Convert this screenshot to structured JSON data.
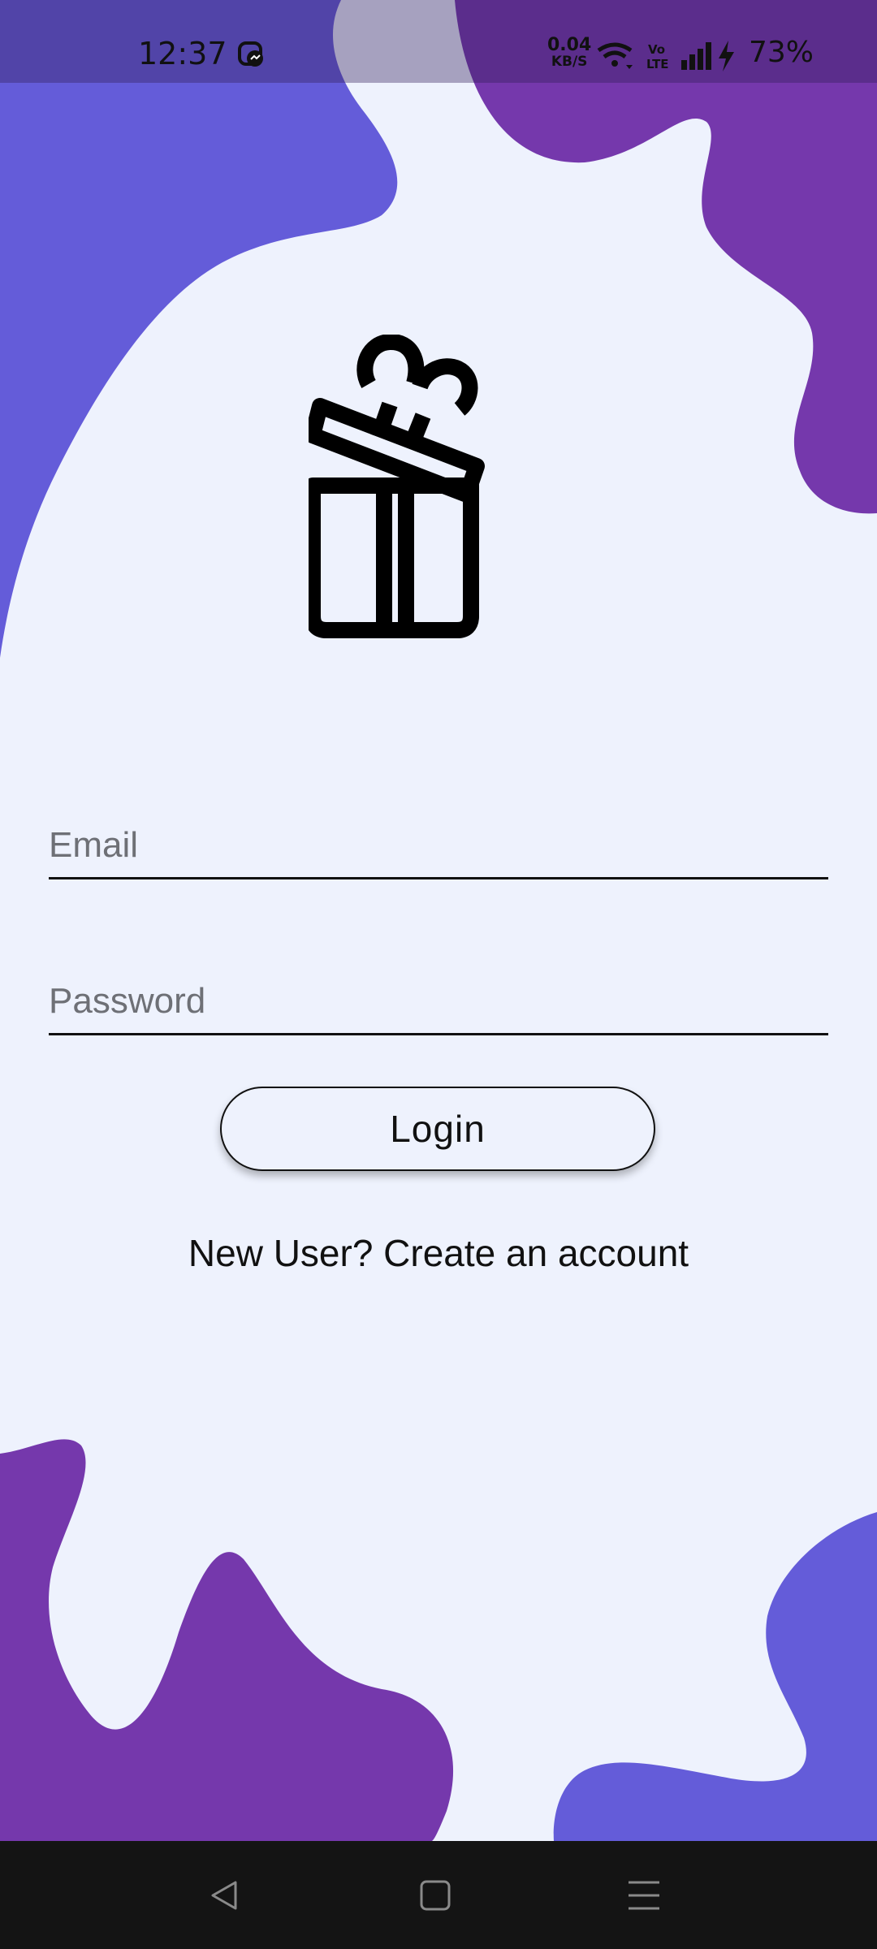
{
  "status_bar": {
    "time": "12:37",
    "network_speed_value": "0.04",
    "network_speed_unit": "KB/S",
    "battery": "73%",
    "icons": [
      "app-notification-icon",
      "wifi-icon",
      "volte-icon",
      "signal-icon",
      "charging-icon"
    ]
  },
  "login_form": {
    "email_placeholder": "Email",
    "password_placeholder": "Password",
    "login_label": "Login",
    "signup_text": "New User? Create an account"
  },
  "nav_bar": {
    "icons": [
      "back-icon",
      "home-icon",
      "recents-menu-icon"
    ]
  },
  "colors": {
    "background": "#EEF2FD",
    "blob_indigo": "#645CD9",
    "blob_purple": "#7538AC",
    "nav_bar": "#141414"
  }
}
